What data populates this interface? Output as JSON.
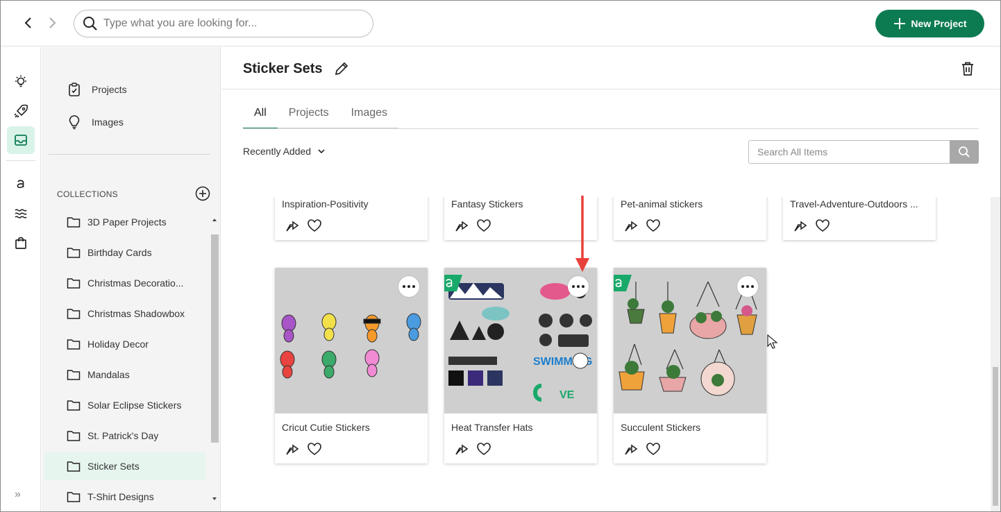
{
  "topbar": {
    "search_placeholder": "Type what you are looking for...",
    "new_project_label": "New Project",
    "accent_color": "#0d7b52"
  },
  "rail": {
    "items": [
      "lightbulb-icon",
      "rocket-icon",
      "inbox-icon",
      "access-icon",
      "wave-icon",
      "shopping-bag-icon"
    ],
    "active": "inbox-icon"
  },
  "sidebar": {
    "links": [
      {
        "label": "Projects",
        "icon": "clipboard-icon"
      },
      {
        "label": "Images",
        "icon": "bulb-icon"
      }
    ],
    "collections_title": "COLLECTIONS",
    "collections": [
      "3D Paper Projects",
      "Birthday Cards",
      "Christmas Decoratio...",
      "Christmas Shadowbox",
      "Holiday Decor",
      "Mandalas",
      "Solar Eclipse Stickers",
      "St. Patrick's Day",
      "Sticker Sets",
      "T-Shirt Designs"
    ],
    "active_collection": "Sticker Sets"
  },
  "main": {
    "title": "Sticker Sets",
    "tabs": [
      {
        "label": "All",
        "active": true
      },
      {
        "label": "Projects",
        "active": false
      },
      {
        "label": "Images",
        "active": false
      }
    ],
    "sort_label": "Recently Added",
    "search_placeholder": "Search All Items",
    "cards_row1": [
      {
        "name": "Inspiration-Positivity"
      },
      {
        "name": "Fantasy Stickers"
      },
      {
        "name": "Pet-animal stickers"
      },
      {
        "name": "Travel-Adventure-Outdoors ..."
      }
    ],
    "cards_row2": [
      {
        "name": "Cricut Cutie Stickers",
        "access": false
      },
      {
        "name": "Heat Transfer Hats",
        "access": true
      },
      {
        "name": "Succulent Stickers",
        "access": true
      }
    ]
  }
}
